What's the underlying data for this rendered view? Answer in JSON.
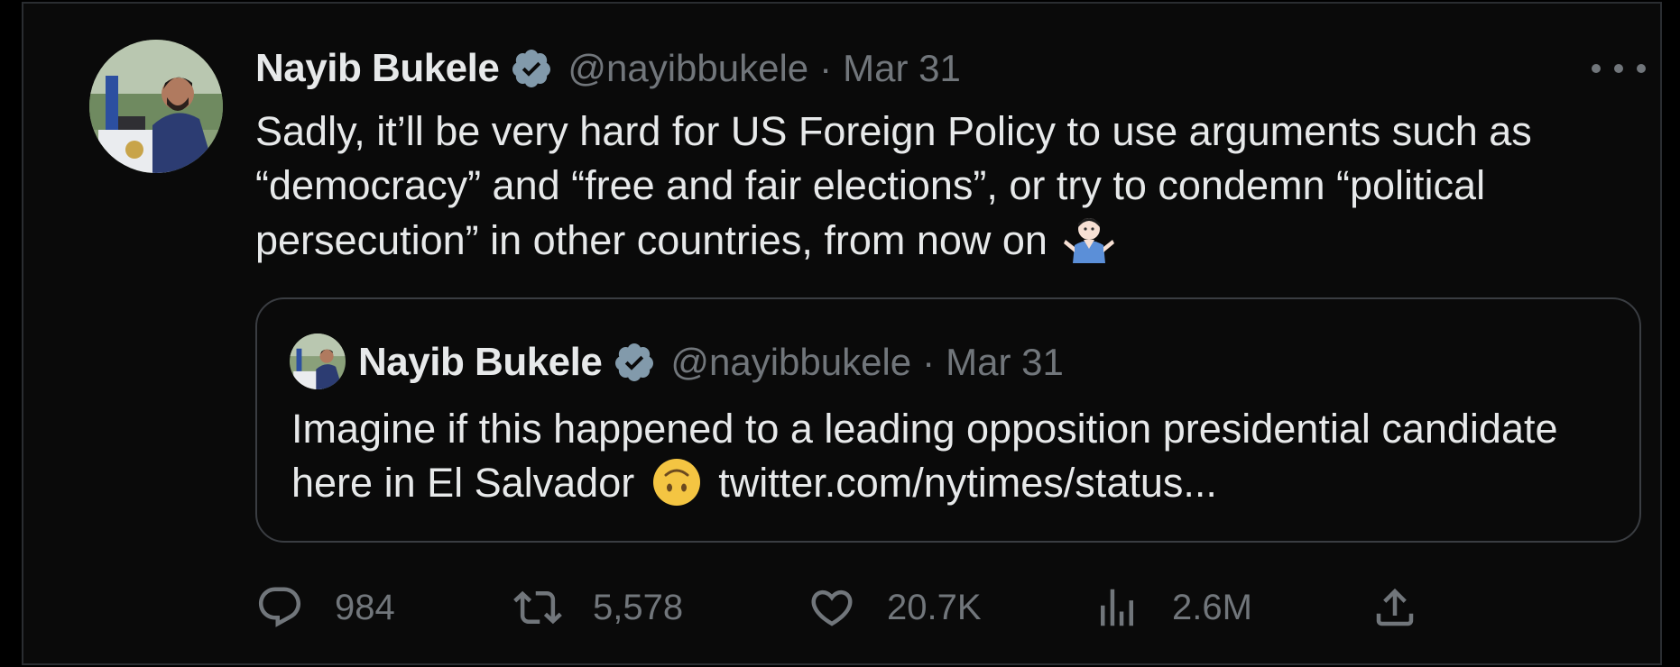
{
  "tweet": {
    "author_name": "Nayib Bukele",
    "handle": "@nayibbukele",
    "separator": "·",
    "date": "Mar 31",
    "text": "Sadly, it’ll be very hard for US Foreign Policy to use arguments such as “democracy” and “free and fair elections”, or try to condemn “political persecution” in other countries, from now on",
    "emoji": "man-shrugging"
  },
  "quoted_tweet": {
    "author_name": "Nayib Bukele",
    "handle": "@nayibbukele",
    "separator": "·",
    "date": "Mar 31",
    "text_before": "Imagine if this happened to a leading opposition presidential candidate here in El Salvador",
    "emoji": "upside-down-face",
    "link": "twitter.com/nytimes/status..."
  },
  "actions": {
    "replies": "984",
    "retweets": "5,578",
    "likes": "20.7K",
    "views": "2.6M"
  },
  "colors": {
    "background": "#0a0a0a",
    "text": "#e7e9ea",
    "muted": "#71767b",
    "verified_badge": "#829aab"
  }
}
